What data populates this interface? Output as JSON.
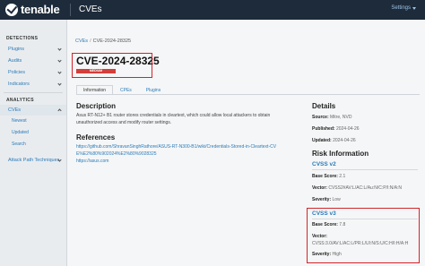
{
  "topbar": {
    "brand": "tenable",
    "title": "CVEs",
    "settings_label": "Settings"
  },
  "sidebar": {
    "detections_heading": "DETECTIONS",
    "detections": [
      "Plugins",
      "Audits",
      "Policies",
      "Indicators"
    ],
    "analytics_heading": "ANALYTICS",
    "cves_label": "CVEs",
    "cve_sub": [
      "Newest",
      "Updated",
      "Search"
    ],
    "attack_path": "Attack Path Techniques"
  },
  "breadcrumb": {
    "root": "CVEs",
    "separator": "/",
    "current": "CVE-2024-28325"
  },
  "cve": {
    "id": "CVE-2024-28325",
    "severity": "MEDIUM"
  },
  "tabs": [
    "Information",
    "CPEs",
    "Plugins"
  ],
  "description": {
    "heading": "Description",
    "text": "Asus RT-N12+ B1 router stores credentials in cleartext, which could allow local attackers to obtain unauthorized access and modify router settings."
  },
  "references": {
    "heading": "References",
    "links": [
      "https://github.com/ShravanSinghRathore/ASUS-RT-N300-B1/wiki/Credentials-Stored-in-Cleartext-CVE%E2%80%902024%E2%80%9028325",
      "https://asus.com"
    ]
  },
  "details": {
    "heading": "Details",
    "source_label": "Source:",
    "source_value": "Mitre, NVD",
    "published_label": "Published:",
    "published_value": "2024-04-26",
    "updated_label": "Updated:",
    "updated_value": "2024-04-26"
  },
  "risk": {
    "heading": "Risk Information",
    "cvss2": {
      "heading": "CVSS v2",
      "base_label": "Base Score:",
      "base_value": "2.1",
      "vector_label": "Vector:",
      "vector_value": "CVSS2#AV:L/AC:L/Au:N/C:P/I:N/A:N",
      "severity_label": "Severity:",
      "severity_value": "Low"
    },
    "cvss3": {
      "heading": "CVSS v3",
      "base_label": "Base Score:",
      "base_value": "7.8",
      "vector_label": "Vector:",
      "vector_value": "CVSS:3.0/AV:L/AC:L/PR:L/UI:N/S:U/C:H/I:H/A:H",
      "severity_label": "Severity:",
      "severity_value": "High"
    }
  }
}
